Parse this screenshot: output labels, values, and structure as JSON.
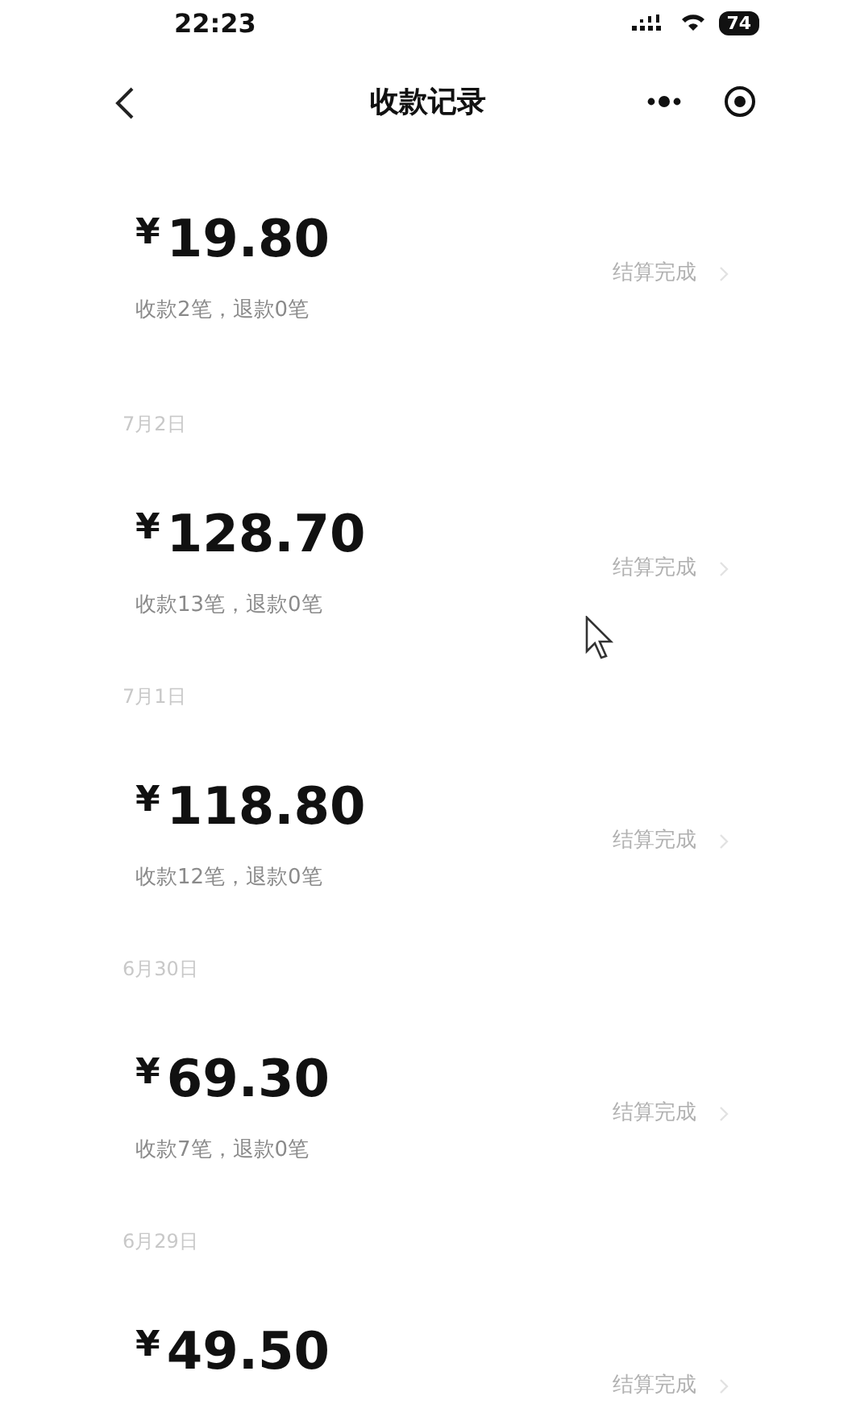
{
  "status_bar": {
    "time": "22:23",
    "battery": "74"
  },
  "header": {
    "title": "收款记录"
  },
  "records": [
    {
      "currency": "¥",
      "amount": "19.80",
      "summary": "收款2笔，退款0笔",
      "status": "结算完成"
    },
    {
      "date": "7月2日",
      "currency": "¥",
      "amount": "128.70",
      "summary": "收款13笔，退款0笔",
      "status": "结算完成"
    },
    {
      "date": "7月1日",
      "currency": "¥",
      "amount": "118.80",
      "summary": "收款12笔，退款0笔",
      "status": "结算完成"
    },
    {
      "date": "6月30日",
      "currency": "¥",
      "amount": "69.30",
      "summary": "收款7笔，退款0笔",
      "status": "结算完成"
    },
    {
      "date": "6月29日",
      "currency": "¥",
      "amount": "49.50",
      "status": "结算完成"
    }
  ]
}
